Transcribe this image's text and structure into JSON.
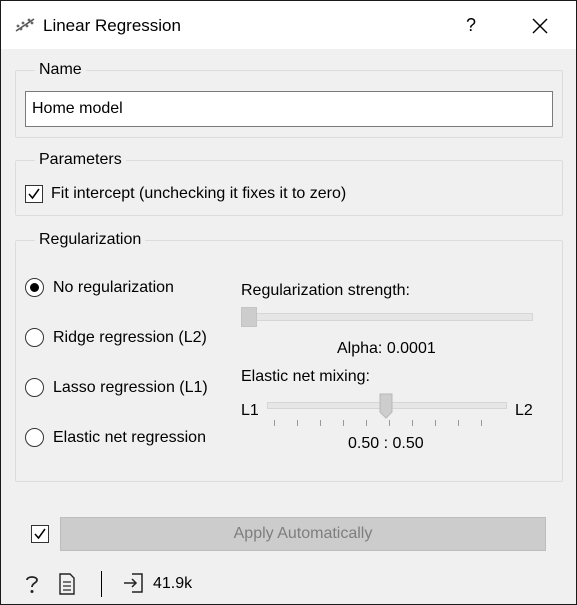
{
  "window": {
    "title": "Linear Regression",
    "help_symbol": "?",
    "icon": "linear-regression-icon"
  },
  "name_group": {
    "title": "Name",
    "value": "Home model"
  },
  "parameters_group": {
    "title": "Parameters",
    "fit_intercept_label": "Fit intercept (unchecking it fixes it to zero)",
    "fit_intercept_checked": true
  },
  "regularization_group": {
    "title": "Regularization",
    "options": [
      {
        "label": "No regularization",
        "selected": true
      },
      {
        "label": "Ridge regression (L2)",
        "selected": false
      },
      {
        "label": "Lasso regression (L1)",
        "selected": false
      },
      {
        "label": "Elastic net regression",
        "selected": false
      }
    ],
    "strength_label": "Regularization strength:",
    "alpha_text": "Alpha: 0.0001",
    "alpha_value": 0.0001,
    "mixing_label": "Elastic net mixing:",
    "mix_left_label": "L1",
    "mix_right_label": "L2",
    "mix_ratio_text": "0.50 : 0.50",
    "mix_value": 0.5
  },
  "footer": {
    "apply_auto_checked": true,
    "apply_label": "Apply Automatically",
    "output_size": "41.9k"
  },
  "colors": {
    "panel_bg": "#f0f0f0",
    "titlebar_bg": "#ffffff",
    "disabled_button": "#cccccc",
    "disabled_text": "#7e7e7e"
  }
}
